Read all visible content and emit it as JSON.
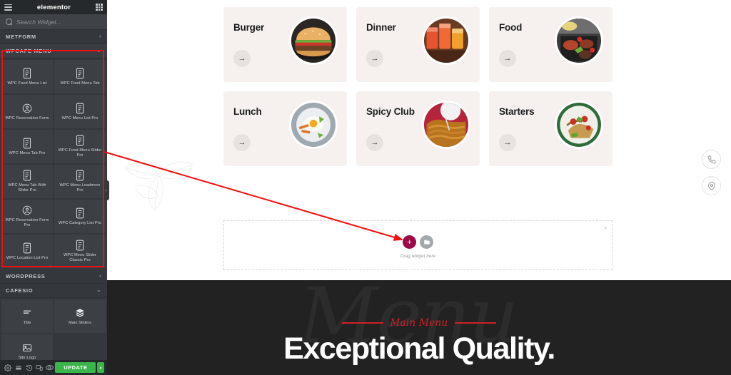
{
  "app": {
    "title": "elementor",
    "menu_icon": "hamburger-icon",
    "apps_icon": "grid-apps-icon"
  },
  "search": {
    "placeholder": "Search Widget...",
    "value": "",
    "icon": "search-icon"
  },
  "categories": [
    {
      "id": "metform",
      "label": "METFORM",
      "state": "collapsed",
      "chevron": "›"
    },
    {
      "id": "wpcafe",
      "label": "WPCAFE MENU",
      "state": "expanded",
      "chevron": "⌄"
    },
    {
      "id": "wordpress",
      "label": "WORDPRESS",
      "state": "collapsed",
      "chevron": "›"
    },
    {
      "id": "cafesio",
      "label": "CAFESIO",
      "state": "expanded",
      "chevron": "⌄"
    }
  ],
  "wpcafe_widgets": [
    {
      "label": "WPC Food Menu List",
      "icon": "menu-list-icon"
    },
    {
      "label": "WPC Food Menu Tab",
      "icon": "menu-list-icon"
    },
    {
      "label": "WPC Reservation Form",
      "icon": "user-circle-icon"
    },
    {
      "label": "WPC Menu List Pro",
      "icon": "menu-list-icon"
    },
    {
      "label": "WPC Menu Tab Pro",
      "icon": "menu-list-icon"
    },
    {
      "label": "WPC Food Menu Slider Pro",
      "icon": "menu-list-icon"
    },
    {
      "label": "WPC Menu Tab With Slider Pro",
      "icon": "menu-list-icon"
    },
    {
      "label": "WPC Menu Loadmore Pro",
      "icon": "menu-list-icon"
    },
    {
      "label": "WPC Reservation Form Pro",
      "icon": "user-circle-icon"
    },
    {
      "label": "WPC Category List Pro",
      "icon": "menu-list-icon"
    },
    {
      "label": "WPC Location List Pro",
      "icon": "menu-list-icon"
    },
    {
      "label": "WPC Menu Slider Classic Pro",
      "icon": "menu-list-icon"
    }
  ],
  "cafesio_widgets": [
    {
      "label": "Title",
      "icon": "title-icon"
    },
    {
      "label": "Main Sliders",
      "icon": "layers-icon"
    },
    {
      "label": "Site Logo",
      "icon": "image-icon"
    }
  ],
  "footer": {
    "icons": [
      {
        "name": "settings-gear-icon"
      },
      {
        "name": "navigator-icon"
      },
      {
        "name": "history-icon"
      },
      {
        "name": "responsive-mode-icon"
      },
      {
        "name": "preview-eye-icon"
      }
    ],
    "update_label": "UPDATE",
    "update_caret": "▴",
    "update_color": "#39b54a"
  },
  "collapse_handle": {
    "icon": "chevron-left-icon",
    "glyph": "‹"
  },
  "canvas": {
    "cards": [
      {
        "title": "Burger",
        "arrow": "→",
        "thumb": "burger-photo"
      },
      {
        "title": "Dinner",
        "arrow": "→",
        "thumb": "drinks-photo"
      },
      {
        "title": "Food",
        "arrow": "→",
        "thumb": "platter-photo"
      },
      {
        "title": "Lunch",
        "arrow": "→",
        "thumb": "eggplate-photo"
      },
      {
        "title": "Spicy Club",
        "arrow": "→",
        "thumb": "noodles-photo"
      },
      {
        "title": "Starters",
        "arrow": "→",
        "thumb": "salad-photo"
      }
    ],
    "dropzone": {
      "label": "Drag widget here",
      "add_glyph": "+",
      "folder_icon": "folder-icon",
      "close_glyph": "×",
      "add_color": "#9b0a46"
    },
    "hero": {
      "ghost_text": "Menu",
      "subtitle": "Main Menu",
      "title": "Exceptional Quality.",
      "accent_color": "#cf2027",
      "background_color": "#222222"
    },
    "float_buttons": [
      {
        "name": "phone-icon"
      },
      {
        "name": "location-pin-icon"
      }
    ]
  },
  "annotation": {
    "box_color": "#f40d0d",
    "arrow_color": "#f40d0d"
  }
}
